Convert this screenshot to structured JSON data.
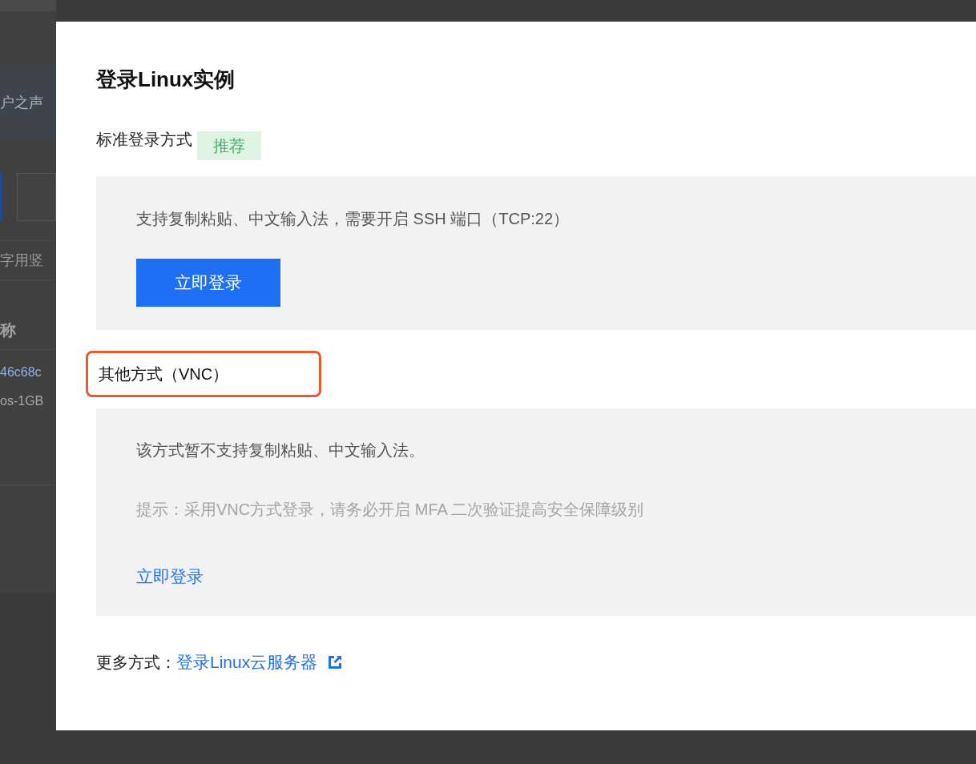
{
  "background_page": {
    "banner_text": "户之声",
    "filter_text": "字用竖",
    "column_header": "称",
    "instance_id": "46c68c",
    "instance_spec": "os-1GB"
  },
  "dialog": {
    "title": "登录Linux实例",
    "standard": {
      "heading": "标准登录方式",
      "tag": "推荐",
      "description": "支持复制粘贴、中文输入法，需要开启 SSH 端口（TCP:22）",
      "button": "立即登录"
    },
    "other": {
      "heading": "其他方式（VNC）",
      "highlighted": true,
      "description": "该方式暂不支持复制粘贴、中文输入法。",
      "hint": "提示：采用VNC方式登录，请务必开启 MFA 二次验证提高安全保障级别",
      "link": "立即登录"
    },
    "more": {
      "label": "更多方式：",
      "link": "登录Linux云服务器"
    }
  }
}
